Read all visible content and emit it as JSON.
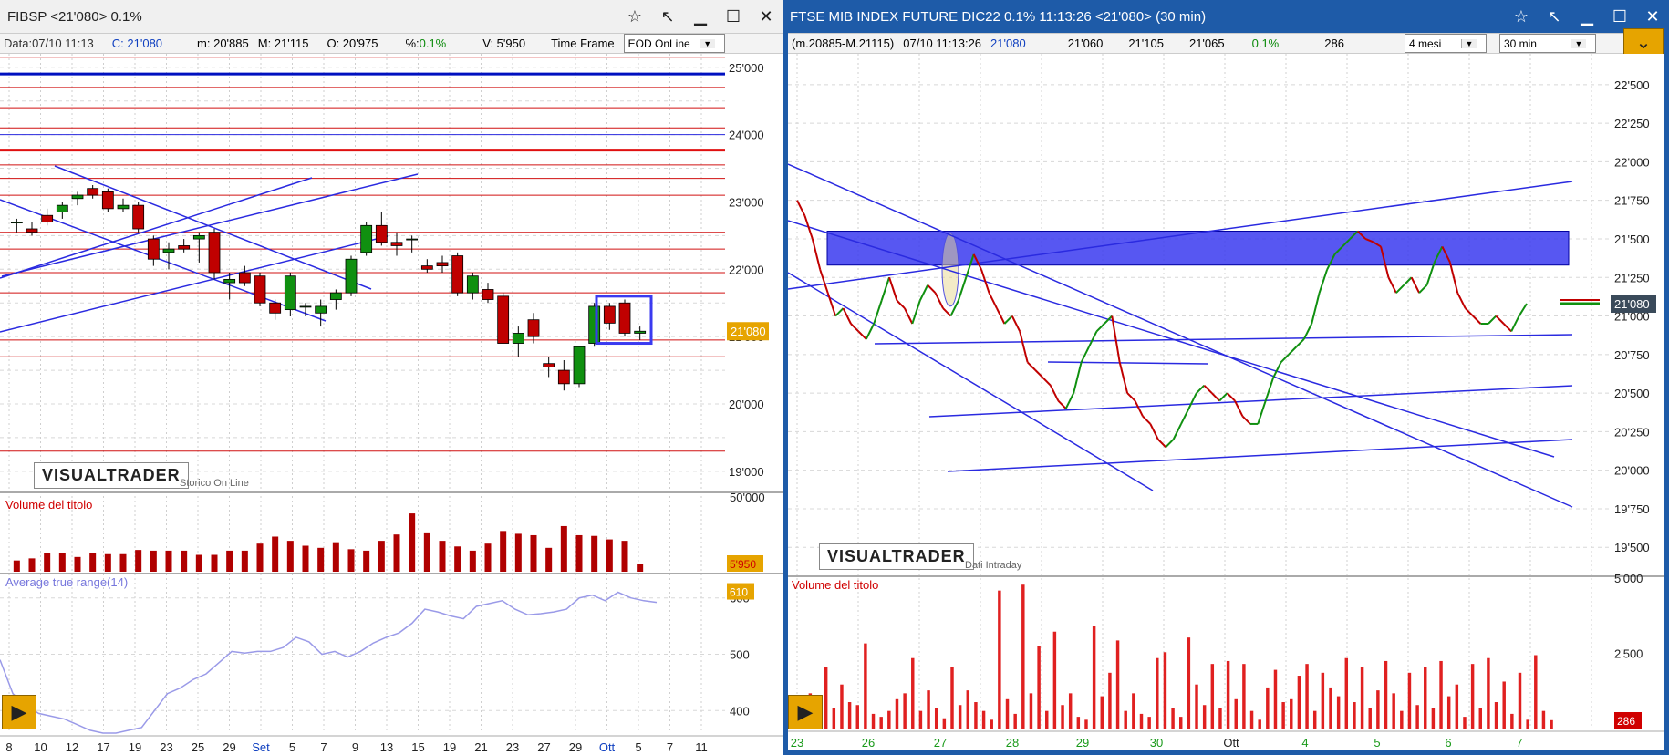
{
  "left": {
    "title": "FIBSP  <21'080>  0.1%",
    "info": {
      "data": "Data:07/10 11:13",
      "close": "C: 21'080",
      "min": "m: 20'885",
      "max": "M: 21'115",
      "open": "O: 20'975",
      "pct_label": "%:",
      "pct": "0.1%",
      "volume": "V: 5'950",
      "timeframe_label": "Time Frame",
      "timeframe_value": "EOD OnLine"
    },
    "logo": "VISUALTRADER",
    "source_label": "Storico On Line",
    "volume_label": "Volume del titolo",
    "volume_value": "5'950",
    "atr_label": "Average true range(14)",
    "atr_value": "610",
    "price_tag": "21'080",
    "x_labels": [
      "8",
      "10",
      "12",
      "17",
      "19",
      "23",
      "25",
      "29",
      "Set",
      "5",
      "7",
      "9",
      "13",
      "15",
      "19",
      "21",
      "23",
      "27",
      "29",
      "Ott",
      "5",
      "7",
      "11"
    ]
  },
  "right": {
    "title": "FTSE MIB INDEX FUTURE DIC22 0.1% 11:13:26  <21'080>  (30 min)",
    "info": {
      "range": "(m.20885-M.21115)",
      "datetime": "07/10 11:13:26",
      "last": "21'080",
      "v1": "21'060",
      "v2": "21'105",
      "v3": "21'065",
      "pct": "0.1%",
      "count": "286",
      "period": "4 mesi",
      "interval": "30 min"
    },
    "logo": "VISUALTRADER",
    "source_label": "Dati Intraday",
    "volume_label": "Volume del titolo",
    "volume_value": "286",
    "price_tag": "21'080",
    "x_labels": [
      "23",
      "26",
      "27",
      "28",
      "29",
      "30",
      "Ott",
      "4",
      "5",
      "6",
      "7"
    ]
  },
  "chart_data": [
    {
      "type": "candlestick",
      "title": "FIBSP",
      "ylim": [
        18700,
        25200
      ],
      "yticks": [
        "25'000",
        "24'000",
        "23'000",
        "22'000",
        "21'000",
        "20'000",
        "19'000"
      ],
      "candles": [
        [
          22700,
          22750,
          22550,
          22700
        ],
        [
          22600,
          22700,
          22500,
          22550
        ],
        [
          22800,
          22900,
          22650,
          22700
        ],
        [
          22850,
          23000,
          22750,
          22950
        ],
        [
          23050,
          23150,
          22950,
          23100
        ],
        [
          23200,
          23250,
          23050,
          23100
        ],
        [
          23150,
          23200,
          22850,
          22900
        ],
        [
          22900,
          23050,
          22850,
          22950
        ],
        [
          22950,
          23000,
          22550,
          22600
        ],
        [
          22450,
          22500,
          22050,
          22150
        ],
        [
          22250,
          22400,
          22000,
          22300
        ],
        [
          22350,
          22450,
          22250,
          22300
        ],
        [
          22450,
          22550,
          22100,
          22500
        ],
        [
          22550,
          22600,
          21850,
          21950
        ],
        [
          21800,
          21950,
          21550,
          21850
        ],
        [
          21950,
          22050,
          21750,
          21800
        ],
        [
          21900,
          21950,
          21450,
          21500
        ],
        [
          21500,
          21550,
          21250,
          21350
        ],
        [
          21400,
          21950,
          21300,
          21900
        ],
        [
          21450,
          21500,
          21300,
          21450
        ],
        [
          21350,
          21550,
          21150,
          21450
        ],
        [
          21550,
          21700,
          21400,
          21650
        ],
        [
          21650,
          22200,
          21600,
          22150
        ],
        [
          22250,
          22700,
          22200,
          22650
        ],
        [
          22650,
          22850,
          22350,
          22400
        ],
        [
          22400,
          22550,
          22200,
          22350
        ],
        [
          22450,
          22500,
          22250,
          22450
        ],
        [
          22050,
          22150,
          21950,
          22000
        ],
        [
          22100,
          22200,
          21950,
          22050
        ],
        [
          22200,
          22250,
          21600,
          21650
        ],
        [
          21650,
          21950,
          21550,
          21900
        ],
        [
          21700,
          21800,
          21500,
          21550
        ],
        [
          21600,
          21650,
          20950,
          20900
        ],
        [
          20900,
          21150,
          20700,
          21050
        ],
        [
          21250,
          21350,
          20900,
          21000
        ],
        [
          20600,
          20700,
          20400,
          20550
        ],
        [
          20500,
          20650,
          20200,
          20300
        ],
        [
          20300,
          20850,
          20250,
          20850
        ],
        [
          20900,
          21500,
          20850,
          21450
        ],
        [
          21450,
          21500,
          21100,
          21200
        ],
        [
          21500,
          21550,
          21000,
          21050
        ],
        [
          21050,
          21150,
          20950,
          21080
        ]
      ],
      "volumes": [
        0.16,
        0.19,
        0.26,
        0.26,
        0.21,
        0.26,
        0.25,
        0.25,
        0.31,
        0.3,
        0.3,
        0.3,
        0.24,
        0.24,
        0.3,
        0.3,
        0.4,
        0.5,
        0.44,
        0.37,
        0.34,
        0.42,
        0.32,
        0.3,
        0.44,
        0.53,
        0.83,
        0.56,
        0.44,
        0.36,
        0.3,
        0.4,
        0.58,
        0.54,
        0.52,
        0.34,
        0.65,
        0.52,
        0.51,
        0.46,
        0.44,
        0.11
      ],
      "atr_ylim": [
        360,
        640
      ],
      "atr_ticks": [
        "600",
        "500",
        "400"
      ],
      "atr": [
        490,
        430,
        410,
        395,
        390,
        385,
        375,
        365,
        360,
        360,
        365,
        370,
        400,
        430,
        440,
        455,
        465,
        485,
        505,
        502,
        505,
        505,
        512,
        530,
        522,
        500,
        505,
        495,
        505,
        520,
        530,
        538,
        555,
        580,
        575,
        568,
        563,
        585,
        590,
        595,
        580,
        570,
        572,
        575,
        580,
        600,
        605,
        595,
        610,
        600,
        595,
        592
      ]
    },
    {
      "type": "line",
      "title": "FTSE MIB INDEX FUTURE DIC22",
      "ylim": [
        19330,
        22700
      ],
      "yticks": [
        "22'500",
        "22'250",
        "22'000",
        "21'750",
        "21'500",
        "21'250",
        "21'000",
        "20'750",
        "20'500",
        "20'250",
        "20'000",
        "19'750",
        "19'500"
      ],
      "series_points": [
        [
          0,
          21750
        ],
        [
          1,
          21650
        ],
        [
          2,
          21500
        ],
        [
          3,
          21300
        ],
        [
          4,
          21150
        ],
        [
          5,
          21000
        ],
        [
          6,
          21050
        ],
        [
          7,
          20950
        ],
        [
          8,
          20900
        ],
        [
          9,
          20850
        ],
        [
          10,
          20950
        ],
        [
          11,
          21100
        ],
        [
          12,
          21250
        ],
        [
          13,
          21100
        ],
        [
          14,
          21050
        ],
        [
          15,
          20950
        ],
        [
          16,
          21100
        ],
        [
          17,
          21200
        ],
        [
          18,
          21150
        ],
        [
          19,
          21050
        ],
        [
          20,
          21000
        ],
        [
          21,
          21100
        ],
        [
          22,
          21250
        ],
        [
          23,
          21400
        ],
        [
          24,
          21300
        ],
        [
          25,
          21150
        ],
        [
          26,
          21050
        ],
        [
          27,
          20950
        ],
        [
          28,
          21000
        ],
        [
          29,
          20900
        ],
        [
          30,
          20700
        ],
        [
          31,
          20650
        ],
        [
          32,
          20600
        ],
        [
          33,
          20550
        ],
        [
          34,
          20450
        ],
        [
          35,
          20400
        ],
        [
          36,
          20500
        ],
        [
          37,
          20700
        ],
        [
          38,
          20800
        ],
        [
          39,
          20900
        ],
        [
          40,
          20950
        ],
        [
          41,
          21000
        ],
        [
          42,
          20700
        ],
        [
          43,
          20500
        ],
        [
          44,
          20450
        ],
        [
          45,
          20350
        ],
        [
          46,
          20300
        ],
        [
          47,
          20200
        ],
        [
          48,
          20150
        ],
        [
          49,
          20200
        ],
        [
          50,
          20300
        ],
        [
          51,
          20400
        ],
        [
          52,
          20500
        ],
        [
          53,
          20550
        ],
        [
          54,
          20500
        ],
        [
          55,
          20450
        ],
        [
          56,
          20500
        ],
        [
          57,
          20450
        ],
        [
          58,
          20350
        ],
        [
          59,
          20300
        ],
        [
          60,
          20300
        ],
        [
          61,
          20450
        ],
        [
          62,
          20600
        ],
        [
          63,
          20700
        ],
        [
          64,
          20750
        ],
        [
          65,
          20800
        ],
        [
          66,
          20850
        ],
        [
          67,
          20950
        ],
        [
          68,
          21150
        ],
        [
          69,
          21300
        ],
        [
          70,
          21400
        ],
        [
          71,
          21450
        ],
        [
          72,
          21500
        ],
        [
          73,
          21550
        ],
        [
          74,
          21500
        ],
        [
          75,
          21480
        ],
        [
          76,
          21450
        ],
        [
          77,
          21250
        ],
        [
          78,
          21150
        ],
        [
          79,
          21200
        ],
        [
          80,
          21250
        ],
        [
          81,
          21150
        ],
        [
          82,
          21200
        ],
        [
          83,
          21350
        ],
        [
          84,
          21450
        ],
        [
          85,
          21350
        ],
        [
          86,
          21150
        ],
        [
          87,
          21050
        ],
        [
          88,
          21000
        ],
        [
          89,
          20950
        ],
        [
          90,
          20950
        ],
        [
          91,
          21000
        ],
        [
          92,
          20950
        ],
        [
          93,
          20900
        ],
        [
          94,
          21000
        ],
        [
          95,
          21080
        ]
      ],
      "volume_max": 5000,
      "volume_ticks": [
        "5'000",
        "2'500"
      ],
      "volumes": [
        300,
        1200,
        500,
        2100,
        700,
        1500,
        900,
        800,
        2900,
        500,
        400,
        600,
        1000,
        1200,
        2400,
        600,
        1300,
        700,
        350,
        2100,
        800,
        1300,
        900,
        600,
        300,
        4700,
        1000,
        500,
        4900,
        1200,
        2800,
        600,
        3300,
        800,
        1200,
        400,
        300,
        3500,
        1100,
        1900,
        3000,
        600,
        1200,
        500,
        400,
        2400,
        2600,
        700,
        400,
        3100,
        1500,
        800,
        2200,
        700,
        2300,
        1000,
        2200,
        600,
        300,
        1400,
        2000,
        900,
        1000,
        1800,
        2200,
        600,
        1900,
        1400,
        1100,
        2400,
        900,
        2100,
        700,
        1300,
        2300,
        1200,
        600,
        1900,
        800,
        2100,
        700,
        2300,
        1100,
        1500,
        400,
        2200,
        700,
        2400,
        900,
        1600,
        500,
        1900,
        300,
        2500,
        600,
        286
      ]
    }
  ],
  "colors": {
    "bull": "#109010",
    "bear": "#c00000",
    "hline": "#d01010",
    "blueline": "#2a2ae0",
    "zone": "#3a3af0",
    "gold": "#e6a400",
    "frame": "#1e5ba8",
    "atr": "#9a9ae8",
    "vol": "#b00000"
  }
}
